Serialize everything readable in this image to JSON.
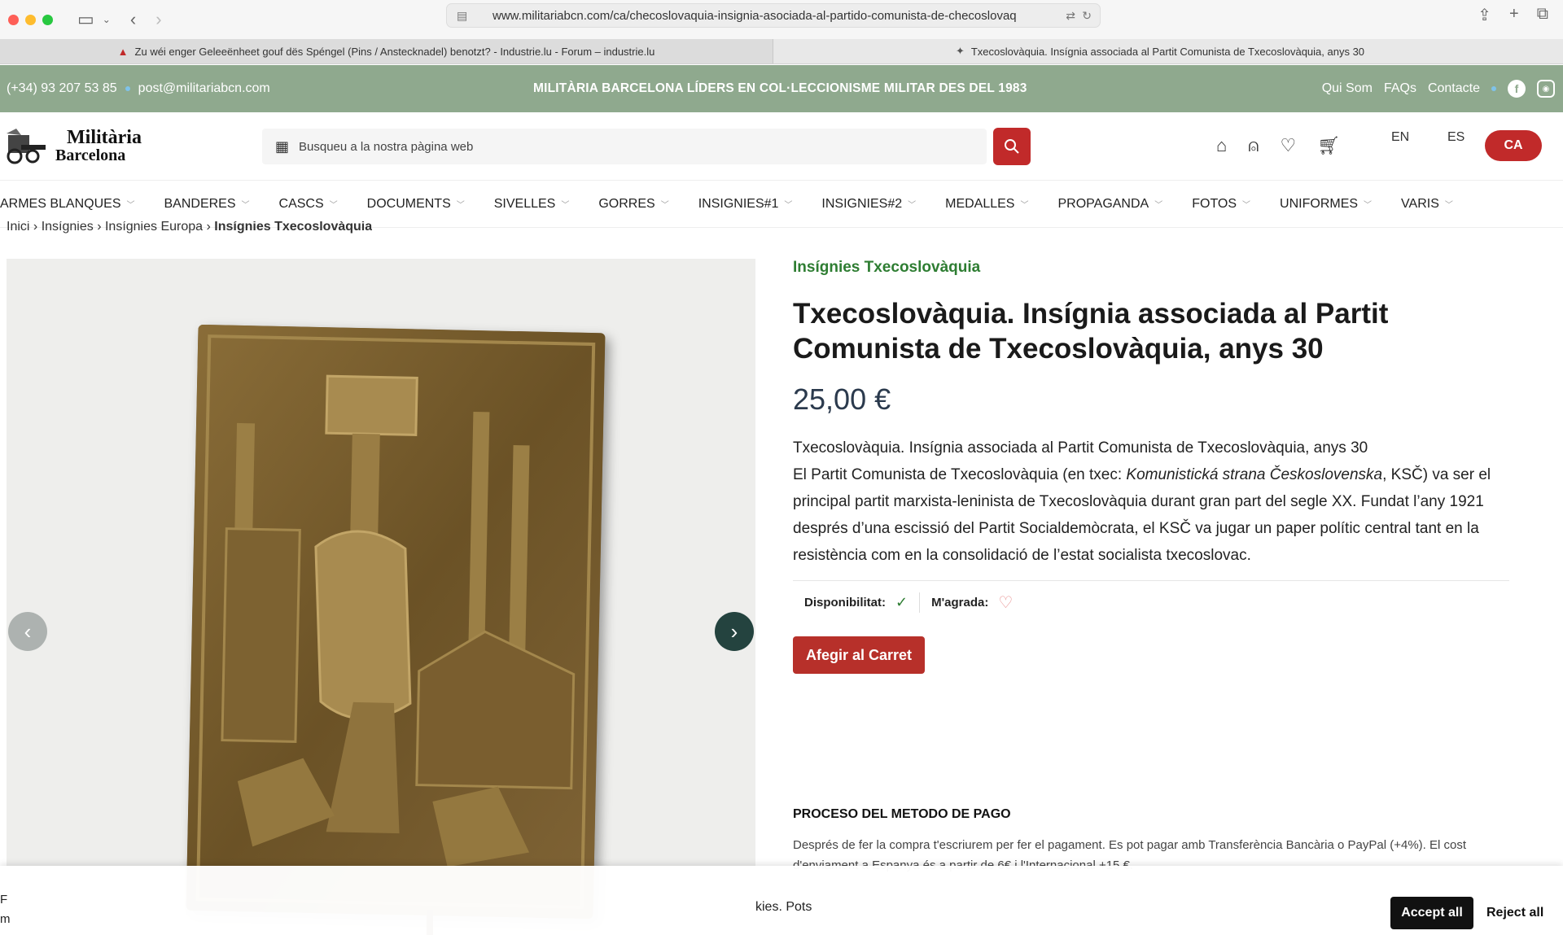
{
  "browser": {
    "url": "www.militariabcn.com/ca/checoslovaquia-insignia-asociada-al-partido-comunista-de-checoslovaq",
    "tabs": [
      {
        "title": "Zu wéi enger Geleeënheet gouf dës Spéngel (Pins / Anstecknadel) benotzt? - Industrie.lu - Forum – industrie.lu",
        "active": false
      },
      {
        "title": "Txecoslovàquia. Insígnia associada al Partit Comunista de Txecoslovàquia, anys 30",
        "active": true
      }
    ]
  },
  "topbar": {
    "phone": "(+34) 93 207 53 85",
    "email": "post@militariabcn.com",
    "slogan": "MILITÀRIA BARCELONA LÍDERS EN COL·LECCIONISME MILITAR DES DEL 1983",
    "links": [
      "Qui Som",
      "FAQs",
      "Contacte"
    ],
    "accent": "#8fa98e"
  },
  "header": {
    "logo_line1": "Militària",
    "logo_line2": "Barcelona",
    "search_placeholder": "Busqueu a la nostra pàgina web",
    "languages": [
      "EN",
      "ES",
      "CA"
    ],
    "active_language": "CA",
    "brand_red": "#c12a2a"
  },
  "nav": [
    "ARMES BLANQUES",
    "BANDERES",
    "CASCS",
    "DOCUMENTS",
    "SIVELLES",
    "GORRES",
    "INSIGNIES#1",
    "INSIGNIES#2",
    "MEDALLES",
    "PROPAGANDA",
    "FOTOS",
    "UNIFORMES",
    "VARIS"
  ],
  "breadcrumb": [
    "Inici",
    "Insígnies",
    "Insígnies Europa",
    "Insígnies Txecoslovàquia"
  ],
  "product": {
    "category": "Insígnies Txecoslovàquia",
    "title": "Txecoslovàquia. Insígnia associada al Partit Comunista de Txecoslovàquia, anys 30",
    "price": "25,00 €",
    "desc_line1": "Txecoslovàquia. Insígnia associada al Partit Comunista de Txecoslovàquia, anys 30",
    "desc_pre": "El Partit Comunista de Txecoslovàquia (en txec: ",
    "desc_italic": "Komunistická strana Československa",
    "desc_post": ", KSČ) va ser el principal partit marxista-leninista de Txecoslovàquia durant gran part del segle XX. Fundat l’any 1921 després d’una escissió del Partit Socialdemòcrata, el KSČ va jugar un paper polític central tant en la resistència com en la consolidació de l’estat socialista txecoslovac.",
    "availability_label": "Disponibilitat:",
    "like_label": "M'agrada:",
    "add_to_cart": "Afegir al Carret"
  },
  "payment": {
    "title": "PROCESO DEL METODO DE PAGO",
    "text": "Després de fer la compra t'escriurem per fer el pagament. Es pot pagar amb Transferència Bancària o PayPal (+4%). El cost d'enviament a Espanya és a partir de 6€ i l'Internacional +15 €."
  },
  "cookie": {
    "left_fragment_1": "F",
    "left_fragment_2": "m",
    "fragment": "kies. Pots",
    "accept": "Accept all",
    "reject": "Reject all"
  }
}
